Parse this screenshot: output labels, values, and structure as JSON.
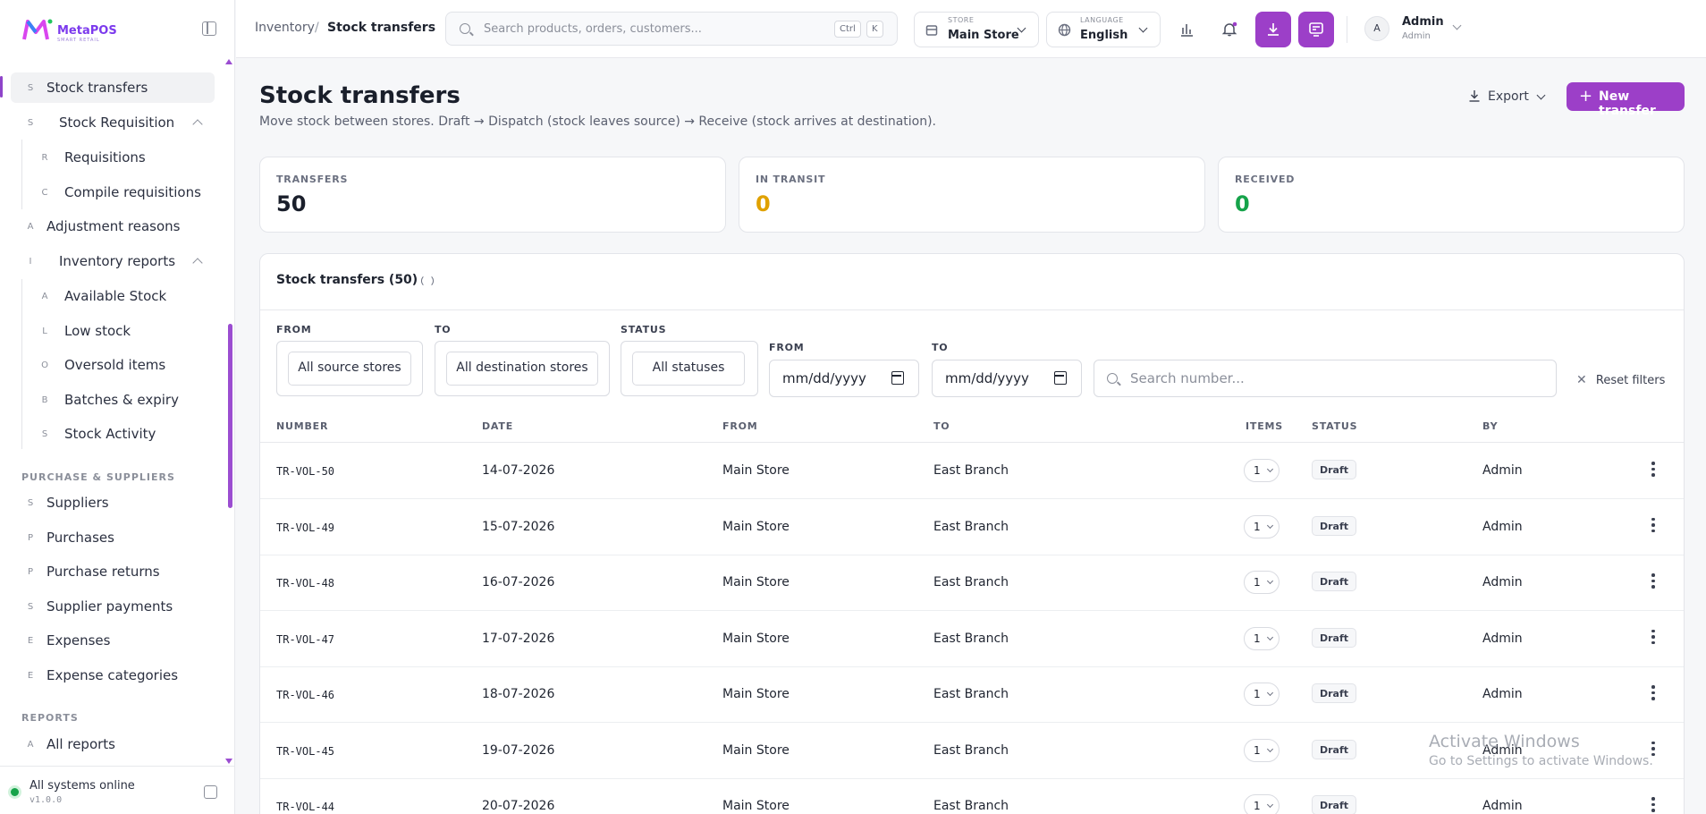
{
  "brand": {
    "name": "MetaPOS",
    "tagline": "SMART RETAIL"
  },
  "sidebar": {
    "items": [
      {
        "letter": "S",
        "label": "Stock transfers"
      },
      {
        "letter": "S",
        "label": "Stock Requisition"
      },
      {
        "letter": "R",
        "label": "Requisitions"
      },
      {
        "letter": "C",
        "label": "Compile requisitions"
      },
      {
        "letter": "A",
        "label": "Adjustment reasons"
      },
      {
        "letter": "I",
        "label": "Inventory reports"
      },
      {
        "letter": "A",
        "label": "Available Stock"
      },
      {
        "letter": "L",
        "label": "Low stock"
      },
      {
        "letter": "O",
        "label": "Oversold items"
      },
      {
        "letter": "B",
        "label": "Batches & expiry"
      },
      {
        "letter": "S",
        "label": "Stock Activity"
      },
      {
        "letter": "S",
        "label": "Suppliers"
      },
      {
        "letter": "P",
        "label": "Purchases"
      },
      {
        "letter": "P",
        "label": "Purchase returns"
      },
      {
        "letter": "S",
        "label": "Supplier payments"
      },
      {
        "letter": "E",
        "label": "Expenses"
      },
      {
        "letter": "E",
        "label": "Expense categories"
      },
      {
        "letter": "A",
        "label": "All reports"
      }
    ],
    "sections": {
      "purchase": "PURCHASE & SUPPLIERS",
      "reports": "REPORTS"
    },
    "footer": {
      "status": "All systems online",
      "version": "v1.0.0"
    }
  },
  "topbar": {
    "breadcrumb": [
      "Inventory",
      "/",
      "Stock transfers"
    ],
    "search_placeholder": "Search products, orders, customers...",
    "kbd": [
      "Ctrl",
      "K"
    ],
    "store": {
      "label": "STORE",
      "value": "Main Store"
    },
    "language": {
      "label": "LANGUAGE",
      "value": "English"
    },
    "user": {
      "initial": "A",
      "name": "Admin",
      "role": "Admin"
    }
  },
  "page": {
    "title": "Stock transfers",
    "description": "Move stock between stores. Draft → Dispatch (stock leaves source) → Receive (stock arrives at destination).",
    "export_label": "Export",
    "new_label": "New transfer"
  },
  "stats": [
    {
      "label": "TRANSFERS",
      "value": "50",
      "color": "#1a1f2b"
    },
    {
      "label": "IN TRANSIT",
      "value": "0",
      "color": "#e0a100"
    },
    {
      "label": "RECEIVED",
      "value": "0",
      "color": "#16a34a"
    }
  ],
  "panel": {
    "title": "Stock transfers (50)",
    "filters": {
      "from_label": "FROM",
      "from_value": "All source stores",
      "to_label": "TO",
      "to_value": "All destination stores",
      "status_label": "STATUS",
      "status_value": "All statuses",
      "date_from_label": "FROM",
      "date_to_label": "TO",
      "date_placeholder": "mm/dd/yyyy",
      "search_placeholder": "Search number...",
      "reset_label": "Reset filters"
    },
    "columns": [
      "NUMBER",
      "DATE",
      "FROM",
      "TO",
      "ITEMS",
      "STATUS",
      "BY"
    ],
    "rows": [
      {
        "number": "TR-VOL-50",
        "date": "14-07-2026",
        "from": "Main Store",
        "to": "East Branch",
        "items": "1",
        "status": "Draft",
        "by": "Admin"
      },
      {
        "number": "TR-VOL-49",
        "date": "15-07-2026",
        "from": "Main Store",
        "to": "East Branch",
        "items": "1",
        "status": "Draft",
        "by": "Admin"
      },
      {
        "number": "TR-VOL-48",
        "date": "16-07-2026",
        "from": "Main Store",
        "to": "East Branch",
        "items": "1",
        "status": "Draft",
        "by": "Admin"
      },
      {
        "number": "TR-VOL-47",
        "date": "17-07-2026",
        "from": "Main Store",
        "to": "East Branch",
        "items": "1",
        "status": "Draft",
        "by": "Admin"
      },
      {
        "number": "TR-VOL-46",
        "date": "18-07-2026",
        "from": "Main Store",
        "to": "East Branch",
        "items": "1",
        "status": "Draft",
        "by": "Admin"
      },
      {
        "number": "TR-VOL-45",
        "date": "19-07-2026",
        "from": "Main Store",
        "to": "East Branch",
        "items": "1",
        "status": "Draft",
        "by": "Admin"
      },
      {
        "number": "TR-VOL-44",
        "date": "20-07-2026",
        "from": "Main Store",
        "to": "East Branch",
        "items": "1",
        "status": "Draft",
        "by": "Admin"
      }
    ]
  },
  "watermark": {
    "line1": "Activate Windows",
    "line2": "Go to Settings to activate Windows."
  }
}
